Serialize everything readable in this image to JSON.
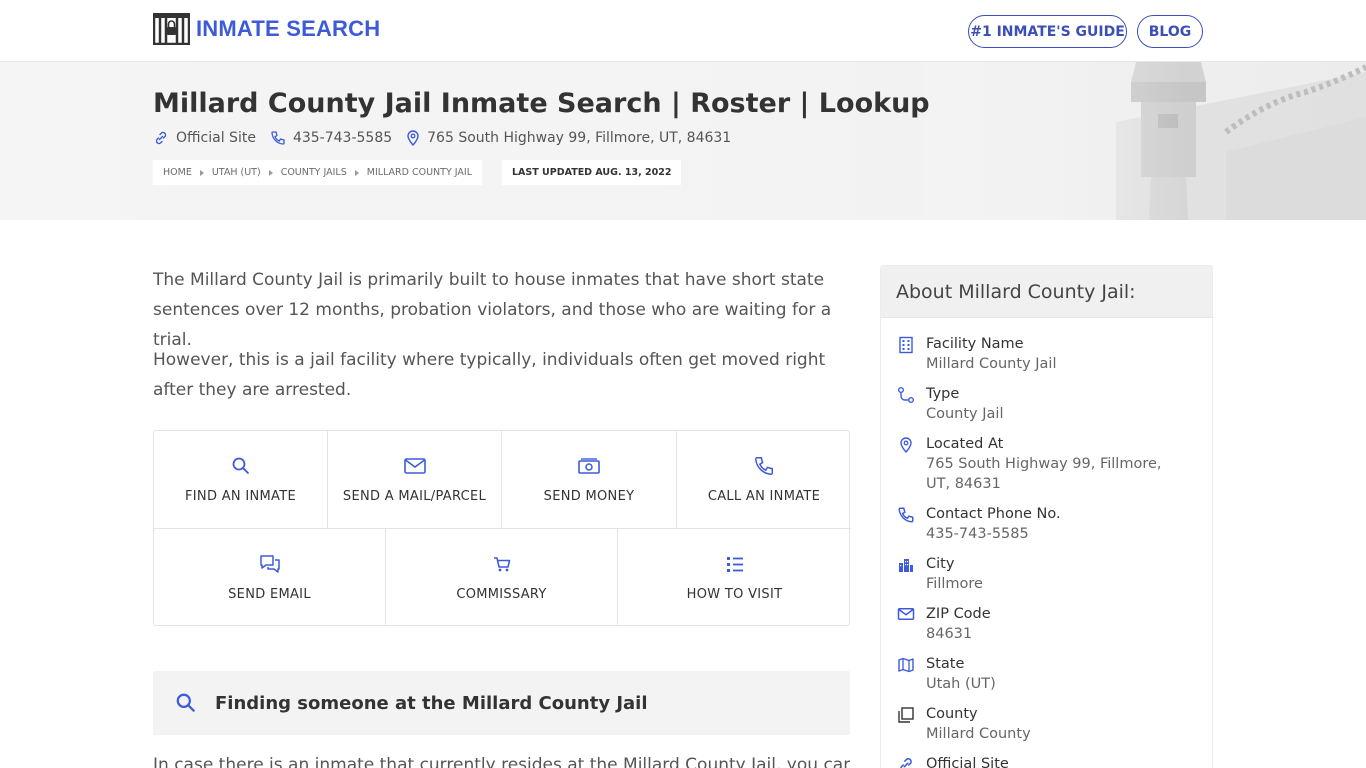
{
  "header": {
    "logo_text": "INMATE SEARCH",
    "nav": {
      "guide": "#1 INMATE'S GUIDE",
      "blog": "BLOG"
    }
  },
  "hero": {
    "title": "Millard County Jail Inmate Search | Roster | Lookup",
    "official_site": "Official Site",
    "phone": "435-743-5585",
    "address": "765 South Highway 99, Fillmore, UT, 84631",
    "breadcrumbs": [
      "HOME",
      "UTAH (UT)",
      "COUNTY JAILS",
      "MILLARD COUNTY JAIL"
    ],
    "last_updated": "LAST UPDATED AUG. 13, 2022"
  },
  "main": {
    "intro1": "The Millard County Jail is primarily built to house inmates that have short state sentences over 12 months, probation violators, and those who are waiting for a trial.",
    "intro2": "However, this is a jail facility where typically, individuals often get moved right after they are arrested.",
    "actions": {
      "find": "FIND AN INMATE",
      "mail": "SEND A MAIL/PARCEL",
      "money": "SEND MONEY",
      "call": "CALL AN INMATE",
      "email": "SEND EMAIL",
      "commissary": "COMMISSARY",
      "visit": "HOW TO VISIT"
    },
    "finding_title": "Finding someone at the Millard County Jail",
    "finding_para": "In case there is an inmate that currently resides at the Millard County Jail, you can all"
  },
  "sidebar": {
    "title": "About Millard County Jail:",
    "facts": {
      "facility": {
        "label": "Facility Name",
        "value": "Millard County Jail"
      },
      "type": {
        "label": "Type",
        "value": "County Jail"
      },
      "located": {
        "label": "Located At",
        "value": "765 South Highway 99, Fillmore, UT, 84631"
      },
      "phone": {
        "label": "Contact Phone No.",
        "value": "435-743-5585"
      },
      "city": {
        "label": "City",
        "value": "Fillmore"
      },
      "zip": {
        "label": "ZIP Code",
        "value": "84631"
      },
      "state": {
        "label": "State",
        "value": "Utah (UT)"
      },
      "county": {
        "label": "County",
        "value": "Millard County"
      },
      "site": {
        "label": "Official Site"
      }
    }
  },
  "colors": {
    "accent": "#3d5bd9",
    "nav_border": "#3b4fb8"
  }
}
